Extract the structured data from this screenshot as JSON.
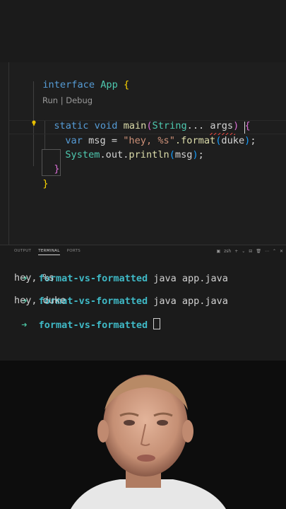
{
  "editor": {
    "line1": {
      "kw": "interface",
      "name": " App ",
      "brace": "{"
    },
    "codelens": "Run | Debug",
    "line2": {
      "static": "static",
      "void": " void ",
      "main": "main",
      "open": "(",
      "type": "String",
      "rest": "... args",
      "close": ")",
      "brace": " {"
    },
    "line3": {
      "var": "var",
      "mid": " msg = ",
      "str": "\"hey, %s\"",
      "fmt": ".format",
      "open": "(",
      "arg": "duke",
      "close": ")",
      "end": ";"
    },
    "line4": {
      "obj": "System",
      "rest": ".out.",
      "fn": "println",
      "open": "(",
      "arg": "msg",
      "close": ")",
      "end": ";"
    },
    "line5": {
      "brace": "}"
    },
    "line6": {
      "brace": "}"
    }
  },
  "panel": {
    "tabs": [
      "OUTPUT",
      "TERMINAL",
      "PORTS"
    ],
    "shell": "zsh",
    "actions": [
      "+",
      "⌄",
      "⊟",
      "🗑",
      "⋯",
      "⌃",
      "✕"
    ]
  },
  "terminal": {
    "prompt_arrow": "➜",
    "dir": "format-vs-formatted",
    "cmd": "java app.java",
    "out1": "hey, %s",
    "out2": "hey, duke"
  },
  "colors": {
    "keyword": "#569cd6",
    "type": "#4ec9b0",
    "function": "#dcdcaa",
    "string": "#ce9178",
    "prompt": "#3fb9c6",
    "squiggle": "#e0443e"
  }
}
